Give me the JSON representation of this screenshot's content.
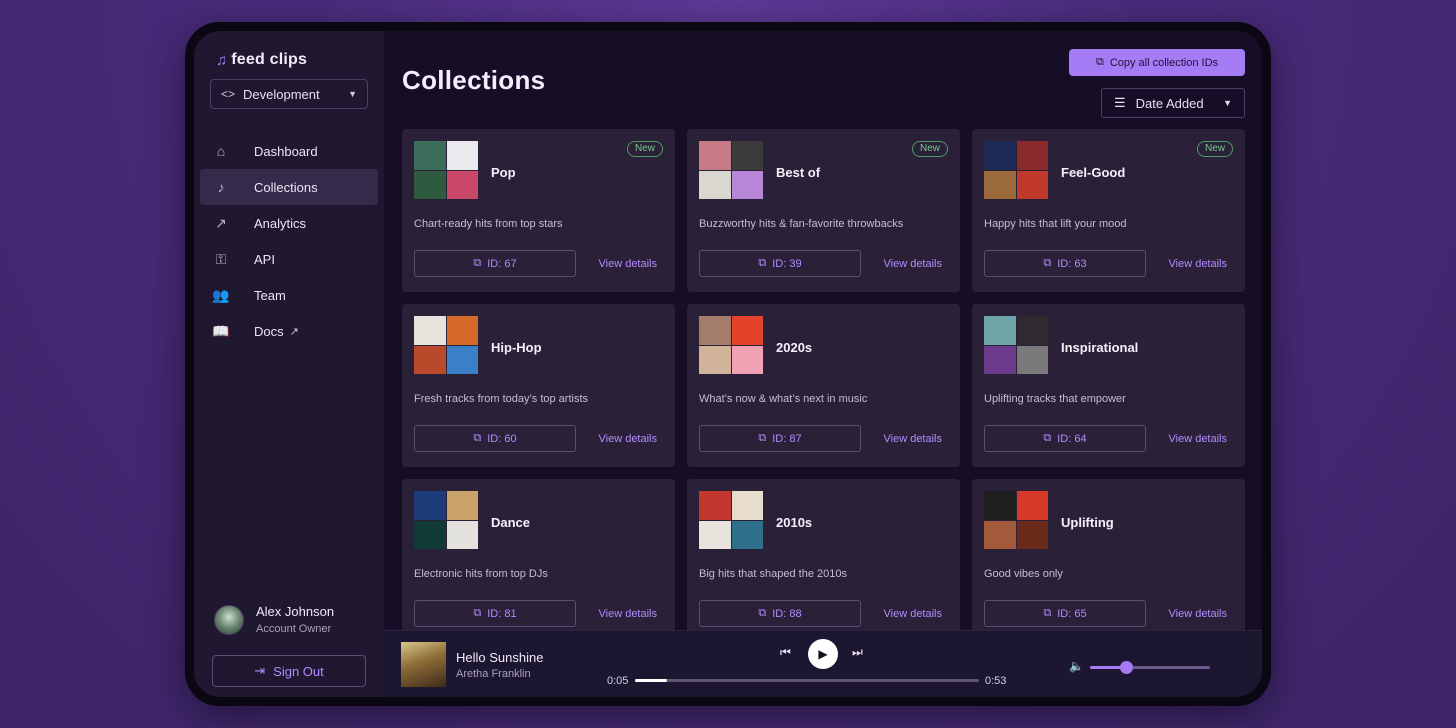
{
  "app": {
    "brand_name": "feed clips",
    "environment": "Development"
  },
  "nav": [
    {
      "label": "Dashboard",
      "icon": "home-icon",
      "glyph": "⌂",
      "active": false
    },
    {
      "label": "Collections",
      "icon": "music-note-icon",
      "glyph": "♪",
      "active": true
    },
    {
      "label": "Analytics",
      "icon": "analytics-icon",
      "glyph": "↗",
      "active": false
    },
    {
      "label": "API",
      "icon": "key-icon",
      "glyph": "⚿",
      "active": false
    },
    {
      "label": "Team",
      "icon": "team-icon",
      "glyph": "👥",
      "active": false
    },
    {
      "label": "Docs",
      "icon": "book-icon",
      "glyph": "📖",
      "active": false,
      "external": true
    }
  ],
  "user": {
    "name": "Alex Johnson",
    "role": "Account Owner"
  },
  "sign_out_label": "Sign Out",
  "page": {
    "title": "Collections",
    "copy_all_label": "Copy all collection IDs",
    "sort_label": "Date Added"
  },
  "collections": [
    {
      "title": "Pop",
      "desc": "Chart-ready hits from top stars",
      "id_label": "ID: 67",
      "badge": "New",
      "cover_colors": [
        "#3b6d5a",
        "#e9e9ee",
        "#2e5a40",
        "#c9486a"
      ]
    },
    {
      "title": "Best of",
      "desc": "Buzzworthy hits & fan-favorite throwbacks",
      "id_label": "ID: 39",
      "badge": "New",
      "cover_colors": [
        "#c67a86",
        "#3b3b3b",
        "#d9d7d0",
        "#b786d6"
      ]
    },
    {
      "title": "Feel-Good",
      "desc": "Happy hits that lift your mood",
      "id_label": "ID: 63",
      "badge": "New",
      "cover_colors": [
        "#1d2a55",
        "#8a2a2a",
        "#9a6a3a",
        "#c0392b"
      ]
    },
    {
      "title": "Hip-Hop",
      "desc": "Fresh tracks from today’s top artists",
      "id_label": "ID: 60",
      "badge": "",
      "cover_colors": [
        "#e7e2dc",
        "#d56a2a",
        "#b84a2b",
        "#3a7fc8"
      ]
    },
    {
      "title": "2020s",
      "desc": "What’s now & what’s next in music",
      "id_label": "ID: 87",
      "badge": "",
      "cover_colors": [
        "#a47d6a",
        "#e2432a",
        "#d1b39a",
        "#f1a3b5"
      ]
    },
    {
      "title": "Inspirational",
      "desc": "Uplifting tracks that empower",
      "id_label": "ID: 64",
      "badge": "",
      "cover_colors": [
        "#6da5a8",
        "#2f2a2f",
        "#6c3a8a",
        "#7a7a7a"
      ]
    },
    {
      "title": "Dance",
      "desc": "Electronic hits from top DJs",
      "id_label": "ID: 81",
      "badge": "",
      "cover_colors": [
        "#1f3c7a",
        "#c9a36a",
        "#0f3b34",
        "#e4e2df"
      ]
    },
    {
      "title": "2010s",
      "desc": "Big hits that shaped the 2010s",
      "id_label": "ID: 88",
      "badge": "",
      "cover_colors": [
        "#c2382e",
        "#e8dccd",
        "#e9e3de",
        "#2f6f8a"
      ]
    },
    {
      "title": "Uplifting",
      "desc": "Good vibes only",
      "id_label": "ID: 65",
      "badge": "",
      "cover_colors": [
        "#1f1f1f",
        "#d8382a",
        "#a35a3a",
        "#6a2a1a"
      ]
    }
  ],
  "view_details_label": "View details",
  "player": {
    "song": "Hello Sunshine",
    "artist": "Aretha Franklin",
    "current_time": "0:05",
    "total_time": "0:53",
    "progress": 0.094,
    "volume": 0.3
  },
  "colors": {
    "accent": "#a67bf6",
    "badge_green": "#79c789",
    "card_bg": "#2a2139"
  }
}
